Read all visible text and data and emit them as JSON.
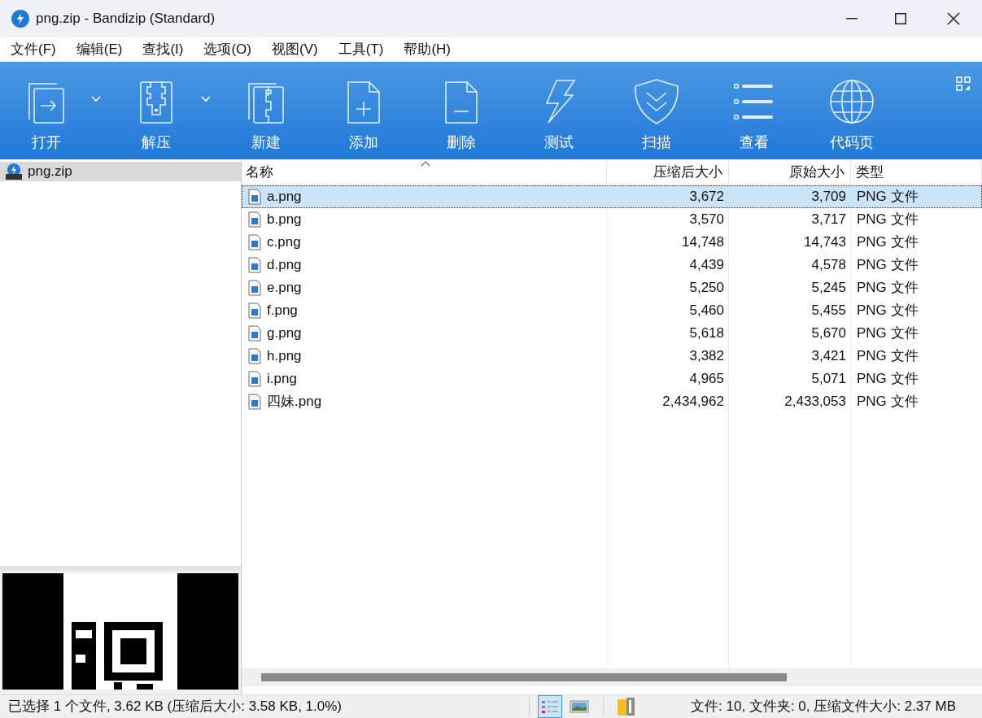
{
  "window": {
    "title": "png.zip - Bandizip (Standard)"
  },
  "menu": [
    "文件(F)",
    "编辑(E)",
    "查找(I)",
    "选项(O)",
    "视图(V)",
    "工具(T)",
    "帮助(H)"
  ],
  "toolbar": [
    {
      "label": "打开",
      "dropdown": true
    },
    {
      "label": "解压",
      "dropdown": true
    },
    {
      "label": "新建",
      "dropdown": false
    },
    {
      "label": "添加",
      "dropdown": false
    },
    {
      "label": "删除",
      "dropdown": false
    },
    {
      "label": "测试",
      "dropdown": false
    },
    {
      "label": "扫描",
      "dropdown": false
    },
    {
      "label": "查看",
      "dropdown": false
    },
    {
      "label": "代码页",
      "dropdown": false
    }
  ],
  "tree": [
    {
      "label": "png.zip",
      "selected": true
    }
  ],
  "table": {
    "columns": [
      "名称",
      "压缩后大小",
      "原始大小",
      "类型"
    ],
    "rows": [
      {
        "cells": [
          "a.png",
          "3,672",
          "3,709",
          "PNG 文件"
        ],
        "selected": true
      },
      {
        "cells": [
          "b.png",
          "3,570",
          "3,717",
          "PNG 文件"
        ],
        "selected": false
      },
      {
        "cells": [
          "c.png",
          "14,748",
          "14,743",
          "PNG 文件"
        ],
        "selected": false
      },
      {
        "cells": [
          "d.png",
          "4,439",
          "4,578",
          "PNG 文件"
        ],
        "selected": false
      },
      {
        "cells": [
          "e.png",
          "5,250",
          "5,245",
          "PNG 文件"
        ],
        "selected": false
      },
      {
        "cells": [
          "f.png",
          "5,460",
          "5,455",
          "PNG 文件"
        ],
        "selected": false
      },
      {
        "cells": [
          "g.png",
          "5,618",
          "5,670",
          "PNG 文件"
        ],
        "selected": false
      },
      {
        "cells": [
          "h.png",
          "3,382",
          "3,421",
          "PNG 文件"
        ],
        "selected": false
      },
      {
        "cells": [
          "i.png",
          "4,965",
          "5,071",
          "PNG 文件"
        ],
        "selected": false
      },
      {
        "cells": [
          "四妹.png",
          "2,434,962",
          "2,433,053",
          "PNG 文件"
        ],
        "selected": false
      }
    ]
  },
  "status_bar": {
    "left": "已选择 1 个文件, 3.62 KB (压缩后大小: 3.58 KB, 1.0%)",
    "views": [
      {
        "selected": true
      },
      {
        "selected": false
      }
    ],
    "right": "文件: 10, 文件夹: 0, 压缩文件大小: 2.37 MB"
  }
}
